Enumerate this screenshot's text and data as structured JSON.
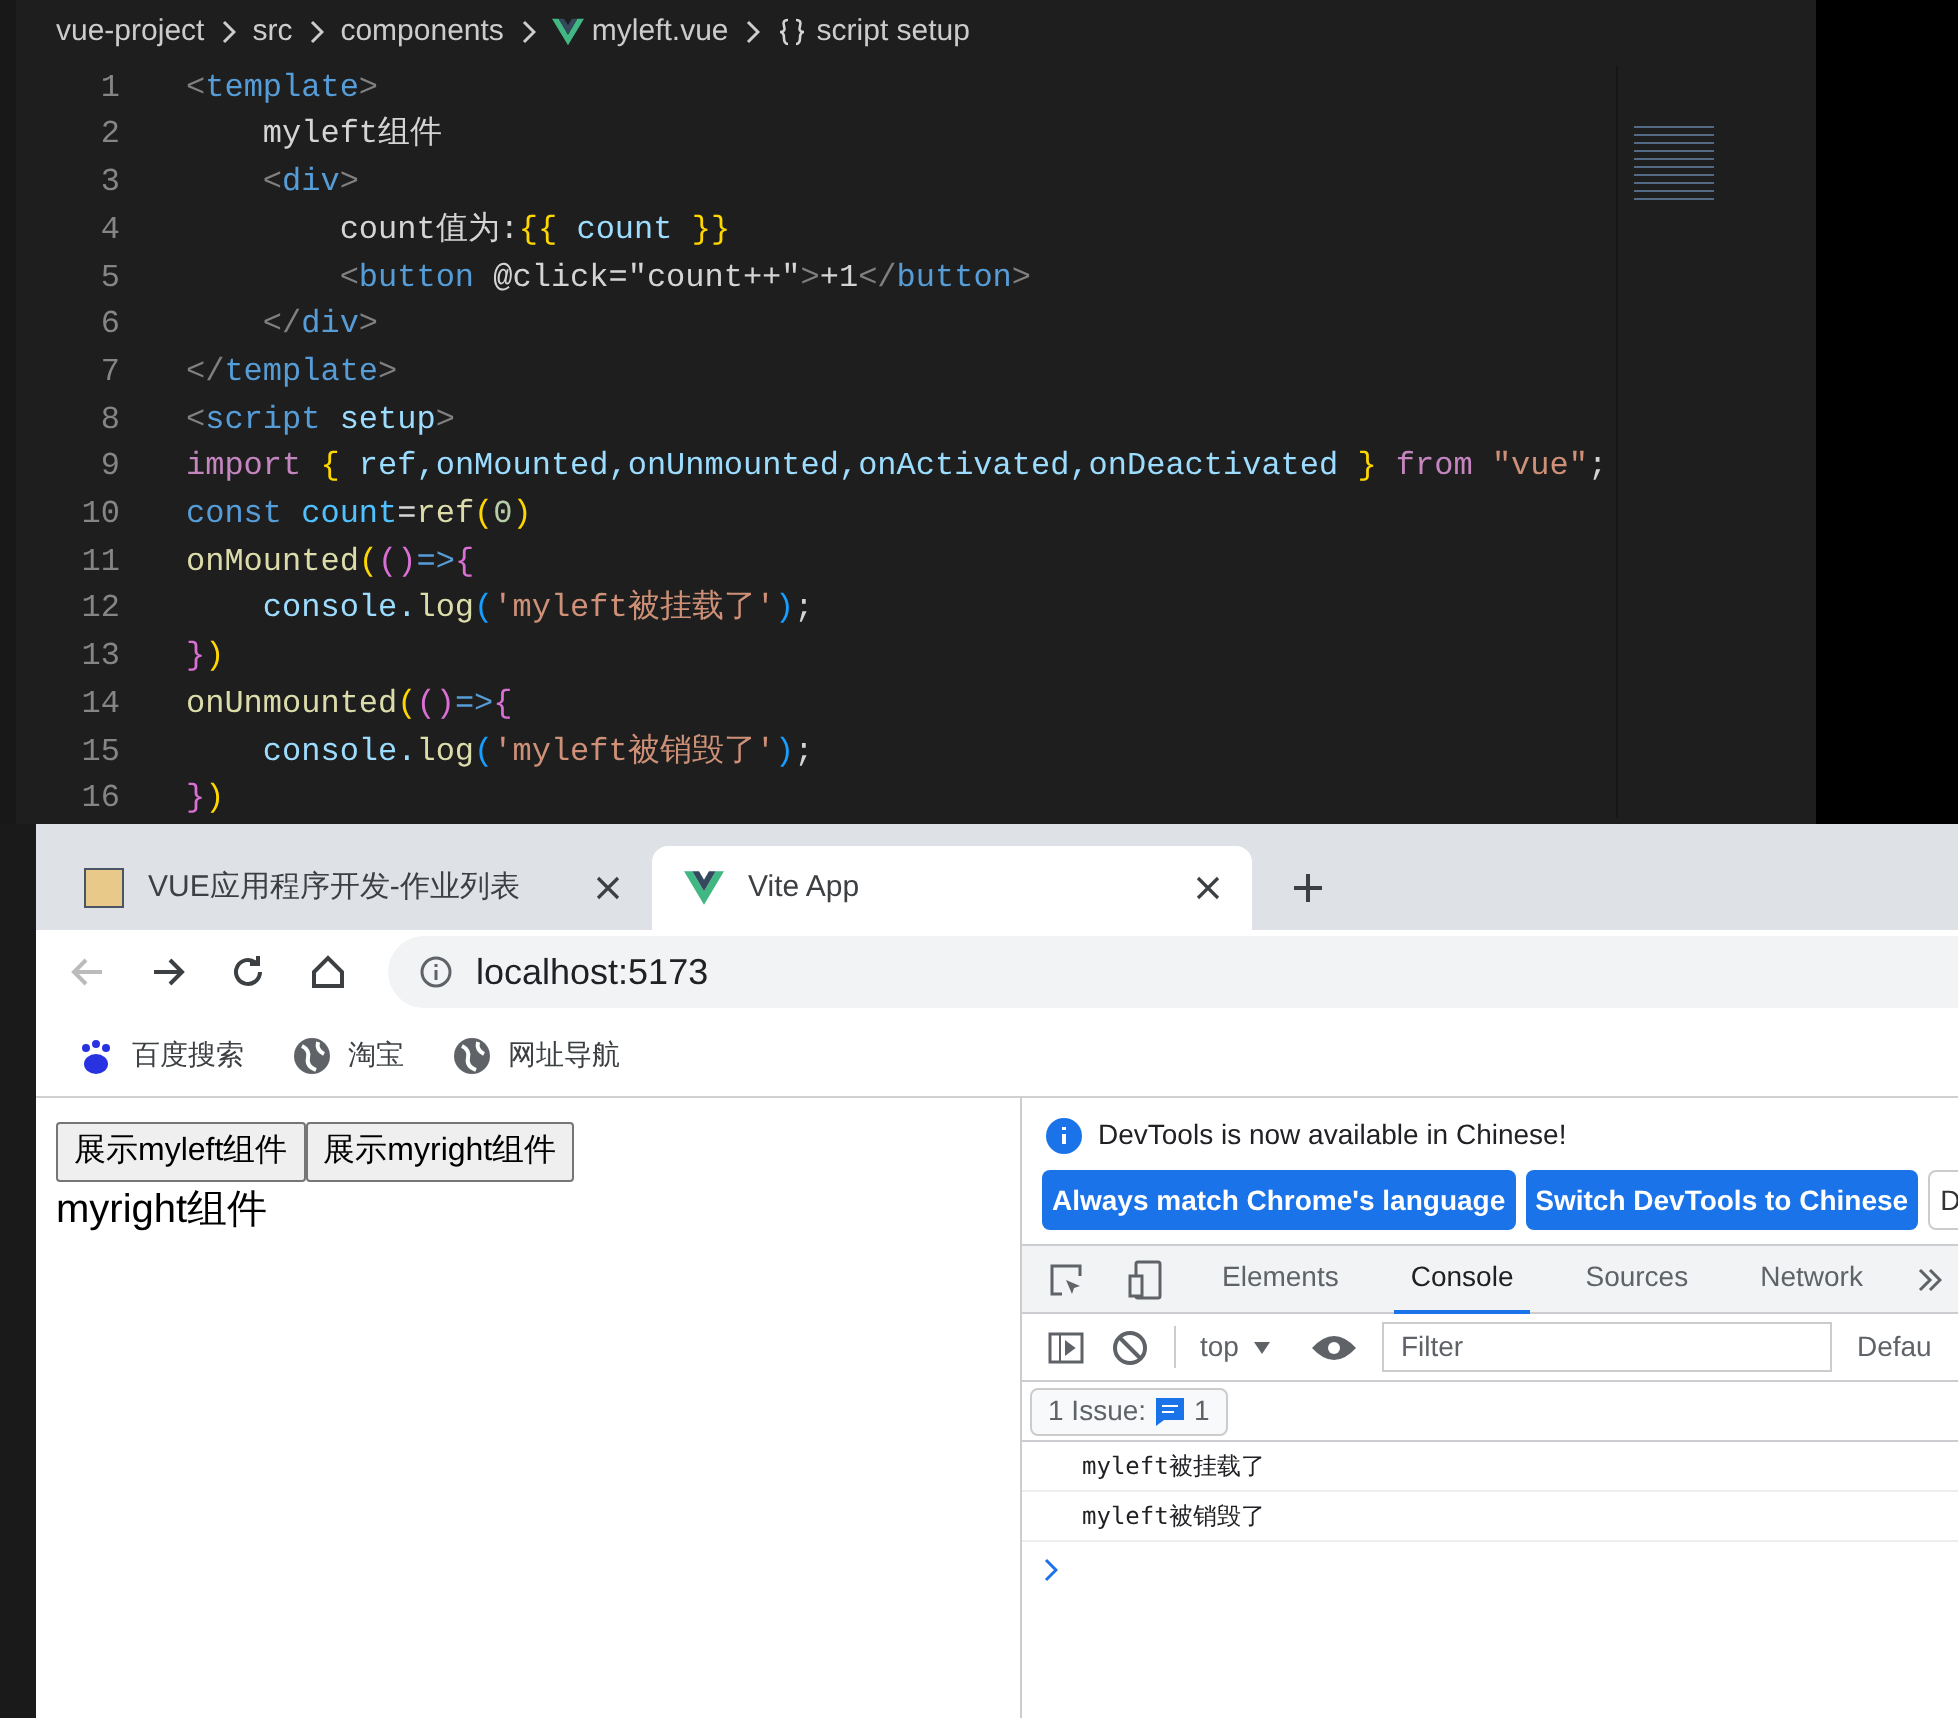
{
  "editor": {
    "breadcrumb": [
      {
        "kind": "folder",
        "text": "vue-project"
      },
      {
        "kind": "folder",
        "text": "src"
      },
      {
        "kind": "folder",
        "text": "components"
      },
      {
        "kind": "vue",
        "text": "myleft.vue"
      },
      {
        "kind": "braces",
        "text": "script setup"
      }
    ],
    "lines": [
      {
        "number": "1",
        "tokens": [
          {
            "kind": "punct",
            "text": "<"
          },
          {
            "kind": "tag",
            "text": "template"
          },
          {
            "kind": "punct",
            "text": ">"
          }
        ]
      },
      {
        "number": "2",
        "tokens": [
          {
            "kind": "plain",
            "text": "    myleft组件"
          }
        ]
      },
      {
        "number": "3",
        "tokens": [
          {
            "kind": "punct",
            "text": "    <"
          },
          {
            "kind": "tag",
            "text": "div"
          },
          {
            "kind": "punct",
            "text": ">"
          }
        ]
      },
      {
        "number": "4",
        "tokens": [
          {
            "kind": "plain",
            "text": "        count值为:"
          },
          {
            "kind": "brace1",
            "text": "{{"
          },
          {
            "kind": "var",
            "text": " count "
          },
          {
            "kind": "brace1",
            "text": "}}"
          }
        ]
      },
      {
        "number": "5",
        "tokens": [
          {
            "kind": "punct",
            "text": "        <"
          },
          {
            "kind": "tag",
            "text": "button"
          },
          {
            "kind": "plain",
            "text": " @click=\"count++\""
          },
          {
            "kind": "punct",
            "text": ">"
          },
          {
            "kind": "plain",
            "text": "+1"
          },
          {
            "kind": "punct",
            "text": "</"
          },
          {
            "kind": "tag",
            "text": "button"
          },
          {
            "kind": "punct",
            "text": ">"
          }
        ]
      },
      {
        "number": "6",
        "tokens": [
          {
            "kind": "punct",
            "text": "    </"
          },
          {
            "kind": "tag",
            "text": "div"
          },
          {
            "kind": "punct",
            "text": ">"
          }
        ]
      },
      {
        "number": "7",
        "tokens": [
          {
            "kind": "punct",
            "text": "</"
          },
          {
            "kind": "tag",
            "text": "template"
          },
          {
            "kind": "punct",
            "text": ">"
          }
        ]
      },
      {
        "number": "8",
        "tokens": [
          {
            "kind": "punct",
            "text": "<"
          },
          {
            "kind": "tag",
            "text": "script"
          },
          {
            "kind": "var",
            "text": " setup"
          },
          {
            "kind": "punct",
            "text": ">"
          }
        ]
      },
      {
        "number": "9",
        "tokens": [
          {
            "kind": "kw",
            "text": "import "
          },
          {
            "kind": "brace1",
            "text": "{"
          },
          {
            "kind": "var",
            "text": " ref,onMounted,onUnmounted,onActivated,onDeactivated "
          },
          {
            "kind": "brace1",
            "text": "}"
          },
          {
            "kind": "kw",
            "text": " from "
          },
          {
            "kind": "str",
            "text": "\"vue\""
          },
          {
            "kind": "plain",
            "text": ";"
          }
        ]
      },
      {
        "number": "10",
        "tokens": [
          {
            "kind": "tag",
            "text": "const "
          },
          {
            "kind": "const",
            "text": "count"
          },
          {
            "kind": "plain",
            "text": "="
          },
          {
            "kind": "fn",
            "text": "ref"
          },
          {
            "kind": "brace1",
            "text": "("
          },
          {
            "kind": "num",
            "text": "0"
          },
          {
            "kind": "brace1",
            "text": ")"
          }
        ]
      },
      {
        "number": "11",
        "tokens": [
          {
            "kind": "fn",
            "text": "onMounted"
          },
          {
            "kind": "brace1",
            "text": "("
          },
          {
            "kind": "brace2",
            "text": "()"
          },
          {
            "kind": "tag",
            "text": "=>"
          },
          {
            "kind": "brace2",
            "text": "{"
          }
        ]
      },
      {
        "number": "12",
        "tokens": [
          {
            "kind": "var",
            "text": "    console."
          },
          {
            "kind": "fn",
            "text": "log"
          },
          {
            "kind": "brace3",
            "text": "("
          },
          {
            "kind": "str",
            "text": "'myleft被挂载了'"
          },
          {
            "kind": "brace3",
            "text": ")"
          },
          {
            "kind": "plain",
            "text": ";"
          }
        ]
      },
      {
        "number": "13",
        "tokens": [
          {
            "kind": "brace2",
            "text": "}"
          },
          {
            "kind": "brace1",
            "text": ")"
          }
        ]
      },
      {
        "number": "14",
        "tokens": [
          {
            "kind": "fn",
            "text": "onUnmounted"
          },
          {
            "kind": "brace1",
            "text": "("
          },
          {
            "kind": "brace2",
            "text": "()"
          },
          {
            "kind": "tag",
            "text": "=>"
          },
          {
            "kind": "brace2",
            "text": "{"
          }
        ]
      },
      {
        "number": "15",
        "tokens": [
          {
            "kind": "var",
            "text": "    console."
          },
          {
            "kind": "fn",
            "text": "log"
          },
          {
            "kind": "brace3",
            "text": "("
          },
          {
            "kind": "str",
            "text": "'myleft被销毁了'"
          },
          {
            "kind": "brace3",
            "text": ")"
          },
          {
            "kind": "plain",
            "text": ";"
          }
        ]
      },
      {
        "number": "16",
        "tokens": [
          {
            "kind": "brace2",
            "text": "}"
          },
          {
            "kind": "brace1",
            "text": ")"
          }
        ]
      }
    ]
  },
  "browser": {
    "tabs": [
      {
        "title": "VUE应用程序开发-作业列表",
        "kind": "image",
        "selected": false
      },
      {
        "title": "Vite App",
        "kind": "vue",
        "selected": true
      }
    ],
    "url": "localhost:5173",
    "bookmarks": [
      {
        "kind": "paw",
        "label": "百度搜索"
      },
      {
        "kind": "globe",
        "label": "淘宝"
      },
      {
        "kind": "globe",
        "label": "网址导航"
      }
    ],
    "page": {
      "buttons": [
        "展示myleft组件",
        "展示myright组件"
      ],
      "text": "myright组件"
    },
    "devtools": {
      "infobar": {
        "message": "DevTools is now available in Chinese!",
        "buttons": [
          "Always match Chrome's language",
          "Switch DevTools to Chinese"
        ],
        "cut_button": "D"
      },
      "tabs": [
        {
          "label": "Elements",
          "selected": false
        },
        {
          "label": "Console",
          "selected": true
        },
        {
          "label": "Sources",
          "selected": false
        },
        {
          "label": "Network",
          "selected": false
        }
      ],
      "context": "top",
      "filter_placeholder": "Filter",
      "levels": "Defau",
      "issues": {
        "label": "1 Issue:",
        "count": "1"
      },
      "messages": [
        "myleft被挂载了",
        "myleft被销毁了"
      ]
    }
  }
}
